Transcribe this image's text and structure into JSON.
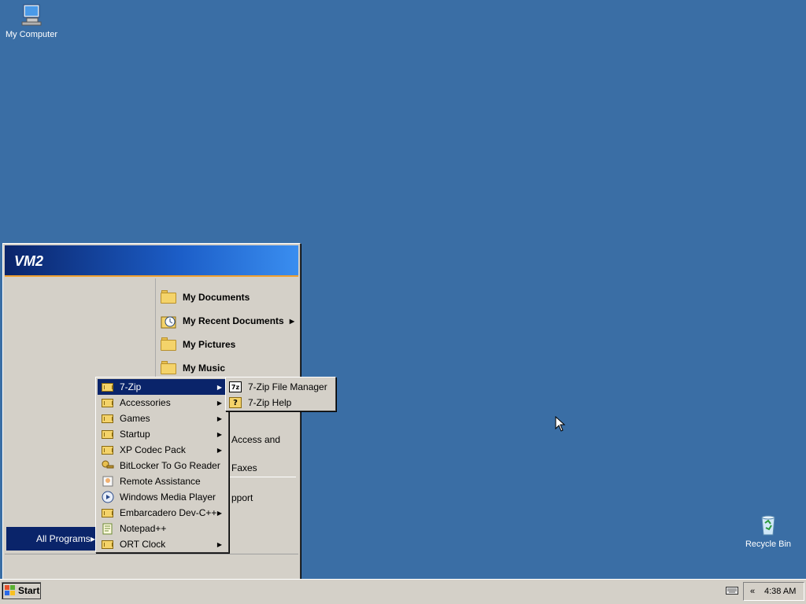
{
  "desktop": {
    "icons": [
      {
        "label": "My Computer",
        "icon": "my-computer-icon"
      },
      {
        "label": "Recycle Bin",
        "icon": "recycle-bin-icon"
      }
    ],
    "background_color": "#3a6ea5"
  },
  "start_menu": {
    "user_name": "VM2",
    "right_items": [
      {
        "label": "My Documents",
        "icon": "folder-documents-icon"
      },
      {
        "label": "My Recent Documents",
        "icon": "recent-documents-icon",
        "submenu": true
      },
      {
        "label": "My Pictures",
        "icon": "folder-pictures-icon"
      },
      {
        "label": "My Music",
        "icon": "folder-music-icon"
      }
    ],
    "partial_items": [
      "Access and",
      "Faxes",
      "pport"
    ],
    "all_programs_label": "All Programs"
  },
  "programs_menu": {
    "items": [
      {
        "label": "7-Zip",
        "icon": "program-group-icon",
        "submenu": true,
        "selected": true
      },
      {
        "label": "Accessories",
        "icon": "program-group-icon",
        "submenu": true
      },
      {
        "label": "Games",
        "icon": "program-group-icon",
        "submenu": true
      },
      {
        "label": "Startup",
        "icon": "program-group-icon",
        "submenu": true
      },
      {
        "label": "XP Codec Pack",
        "icon": "program-group-icon",
        "submenu": true
      },
      {
        "label": "BitLocker To Go Reader",
        "icon": "bitlocker-icon"
      },
      {
        "label": "Remote Assistance",
        "icon": "remote-assistance-icon"
      },
      {
        "label": "Windows Media Player",
        "icon": "media-player-icon"
      },
      {
        "label": "Embarcadero Dev-C++",
        "icon": "program-group-icon",
        "submenu": true
      },
      {
        "label": "Notepad++",
        "icon": "notepad-icon"
      },
      {
        "label": "ORT Clock",
        "icon": "program-group-icon",
        "submenu": true
      }
    ]
  },
  "zip_menu": {
    "items": [
      {
        "label": "7-Zip File Manager",
        "icon": "7z-icon",
        "icon_text": "7z"
      },
      {
        "label": "7-Zip Help",
        "icon": "help-icon",
        "icon_text": "?"
      }
    ]
  },
  "taskbar": {
    "start_label": "Start",
    "tray_chevron": "«",
    "clock": "4:38 AM"
  },
  "colors": {
    "selection": "#0a246a",
    "menu_bg": "#d4d0c8"
  }
}
